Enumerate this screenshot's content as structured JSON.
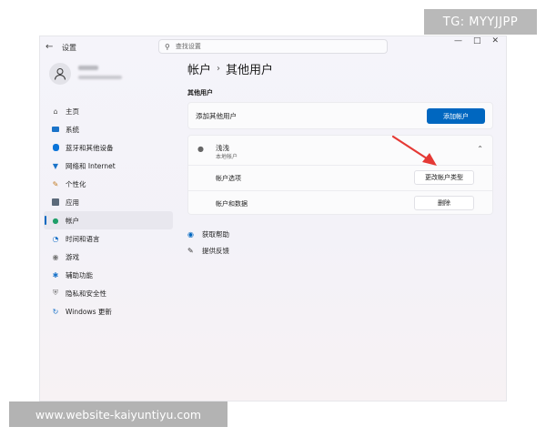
{
  "window": {
    "back_icon": "←",
    "title": "设置",
    "controls": [
      "—",
      "□",
      "✕"
    ]
  },
  "search": {
    "placeholder": "查找设置"
  },
  "sidebar": {
    "items": [
      {
        "icon": "home-icon",
        "label": "主页"
      },
      {
        "icon": "system-icon",
        "label": "系统"
      },
      {
        "icon": "bluetooth-icon",
        "label": "蓝牙和其他设备"
      },
      {
        "icon": "network-icon",
        "label": "网络和 Internet"
      },
      {
        "icon": "brush-icon",
        "label": "个性化"
      },
      {
        "icon": "apps-icon",
        "label": "应用"
      },
      {
        "icon": "account-icon",
        "label": "帐户",
        "active": true
      },
      {
        "icon": "time-language-icon",
        "label": "时间和语言"
      },
      {
        "icon": "gaming-icon",
        "label": "游戏"
      },
      {
        "icon": "accessibility-icon",
        "label": "辅助功能"
      },
      {
        "icon": "shield-icon",
        "label": "隐私和安全性"
      },
      {
        "icon": "windows-update-icon",
        "label": "Windows 更新"
      }
    ]
  },
  "breadcrumb": {
    "parent": "帐户",
    "separator": "›",
    "current": "其他用户"
  },
  "section": {
    "title": "其他用户"
  },
  "add_user": {
    "label": "添加其他用户",
    "button": "添加帐户"
  },
  "user": {
    "name": "浅浅",
    "type": "本地帐户",
    "rows": [
      {
        "label": "帐户选项",
        "button": "更改帐户类型"
      },
      {
        "label": "帐户和数据",
        "button": "删除"
      }
    ]
  },
  "links": {
    "help": "获取帮助",
    "feedback": "提供反馈"
  },
  "watermarks": {
    "tg": "TG: MYYJJPP",
    "url": "www.website-kaiyuntiyu.com"
  },
  "colors": {
    "accent": "#0067c0",
    "annotation_arrow": "#e53935"
  }
}
